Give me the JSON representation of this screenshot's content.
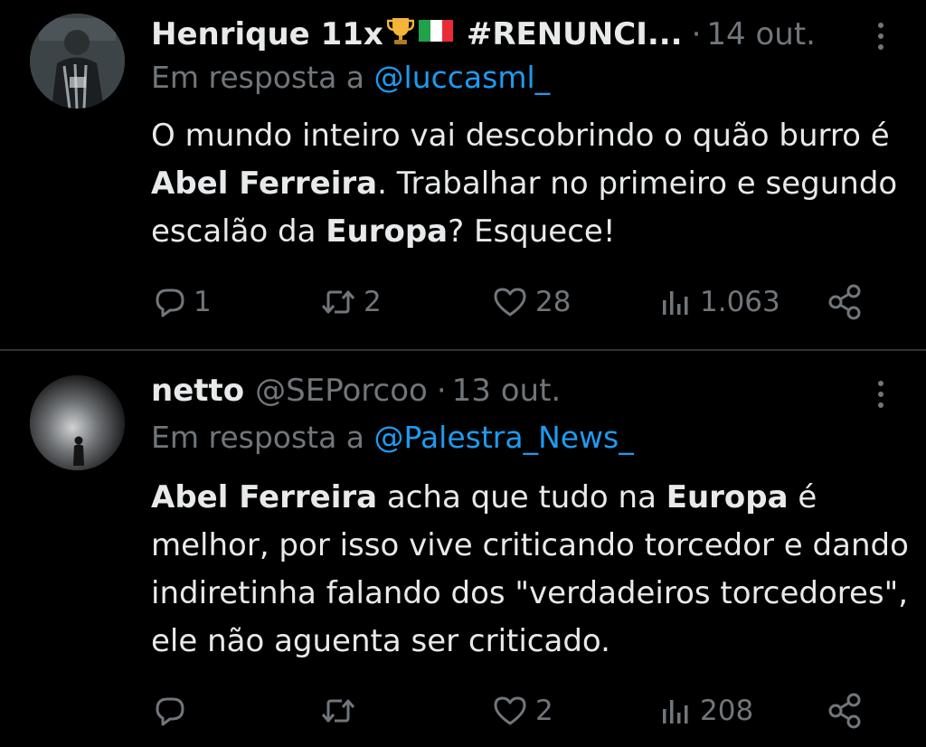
{
  "tweets": [
    {
      "name": "Henrique 11x",
      "name_suffix": "#RENUNCI...",
      "handle": "",
      "date": "14 out.",
      "reply_prefix": "Em resposta a",
      "reply_to": "@luccasml_",
      "body_parts": [
        {
          "text": "O mundo inteiro vai descobrindo o quão burro é ",
          "bold": false
        },
        {
          "text": "Abel Ferreira",
          "bold": true
        },
        {
          "text": ". Trabalhar no primeiro e segundo escalão da ",
          "bold": false
        },
        {
          "text": "Europa",
          "bold": true
        },
        {
          "text": "? Esquece!",
          "bold": false
        }
      ],
      "replies": "1",
      "retweets": "2",
      "likes": "28",
      "views": "1.063"
    },
    {
      "name": "netto",
      "name_suffix": "",
      "handle": "@SEPorcoo",
      "date": "13 out.",
      "reply_prefix": "Em resposta a",
      "reply_to": "@Palestra_News_",
      "body_parts": [
        {
          "text": "Abel Ferreira",
          "bold": true
        },
        {
          "text": " acha que tudo na ",
          "bold": false
        },
        {
          "text": "Europa",
          "bold": true
        },
        {
          "text": " é melhor, por isso vive criticando torcedor e dando indiretinha falando dos \"verdadeiros torcedores\", ele não aguenta ser criticado.",
          "bold": false
        }
      ],
      "replies": "",
      "retweets": "",
      "likes": "2",
      "views": "208"
    }
  ],
  "icons": {
    "trophy": "trophy-icon",
    "flag": "italy-flag-icon",
    "more": "more-vertical-icon",
    "reply": "reply-icon",
    "retweet": "retweet-icon",
    "like": "heart-icon",
    "views": "views-icon",
    "share": "share-icon"
  },
  "colors": {
    "background": "#000000",
    "text": "#e7e9ea",
    "muted": "#71767b",
    "link": "#1d9bf0",
    "divider": "#2f3336"
  }
}
